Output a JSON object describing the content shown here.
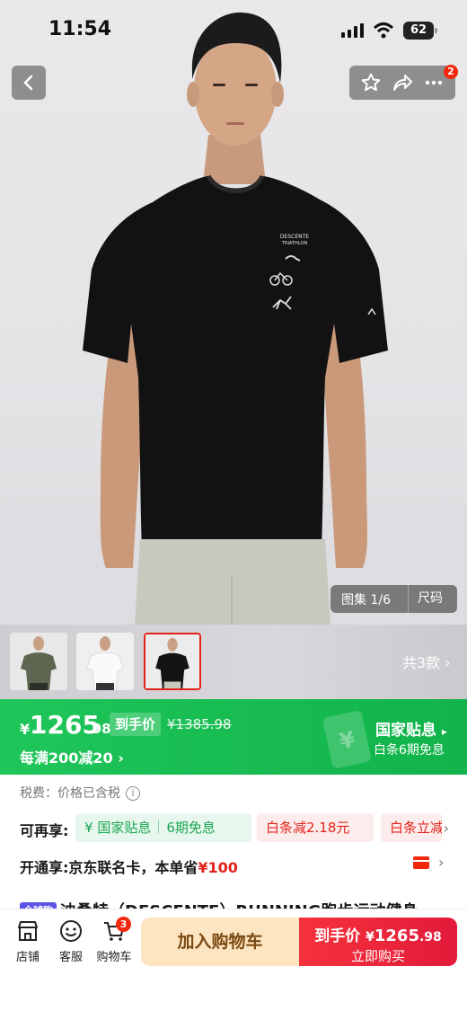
{
  "status_bar": {
    "time": "11:54",
    "battery": "62"
  },
  "nav": {
    "cart_badge": "2"
  },
  "gallery": {
    "label": "图集 1/6",
    "size_tab": "尺码",
    "print_brand": "DESCENTE",
    "print_sub": "TRIATHLON"
  },
  "thumbnails": {
    "count_label": "共3款",
    "colors": [
      "olive",
      "white",
      "black"
    ],
    "selected": 2
  },
  "price": {
    "yen": "¥",
    "integer": "1265",
    "decimal": ".98",
    "tag": "到手价",
    "original": "¥1385.98",
    "promo": "每满200减20",
    "subsidy": "国家贴息",
    "installment": "白条6期免息",
    "band_color": "#1fc65a"
  },
  "tax": {
    "label": "税费：",
    "value": "价格已含税"
  },
  "enjoy": {
    "label": "可再享:",
    "chip_subsidy": "国家贴息",
    "chip_period": "6期免息",
    "chip_discount": "白条减2.18元",
    "chip_more": "白条立减"
  },
  "open": {
    "text": "开通享:京东联名卡，本单省",
    "amount": "¥100"
  },
  "product": {
    "tag": "全球购",
    "title": "迪桑特（DESCENTE）RUNNING跑步运动健身"
  },
  "bottom": {
    "store": "店铺",
    "service": "客服",
    "cart": "购物车",
    "cart_badge": "3",
    "add_to_cart": "加入购物车",
    "buy_price_label": "到手价",
    "buy_price_yen": "¥",
    "buy_price_int": "1265",
    "buy_price_dec": ".98",
    "buy_now": "立即购买"
  }
}
